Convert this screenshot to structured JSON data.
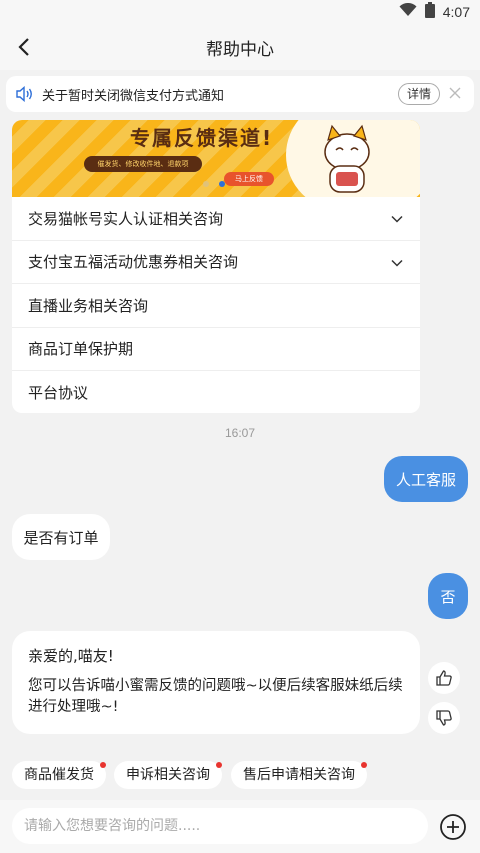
{
  "status_bar": {
    "time": "4:07"
  },
  "header": {
    "title": "帮助中心"
  },
  "notice": {
    "text": "关于暂时关闭微信支付方式通知",
    "detail_label": "详情"
  },
  "banner": {
    "headline": "专属反馈渠道!",
    "pill_text": "催发货、修改收件地、退款项",
    "button_text": "马上反馈"
  },
  "faq_items": [
    {
      "label": "交易猫帐号实人认证相关咨询",
      "expandable": true
    },
    {
      "label": "支付宝五福活动优惠券相关咨询",
      "expandable": true
    },
    {
      "label": "直播业务相关咨询",
      "expandable": false
    },
    {
      "label": "商品订单保护期",
      "expandable": false
    },
    {
      "label": "平台协议",
      "expandable": false
    }
  ],
  "chat": {
    "timestamp": "16:07",
    "messages": [
      {
        "from": "user",
        "text": "人工客服"
      },
      {
        "from": "bot",
        "text": "是否有订单"
      },
      {
        "from": "user",
        "text": "否"
      },
      {
        "from": "bot",
        "lines": [
          "亲爱的,喵友!",
          "您可以告诉喵小蜜需反馈的问题哦~以便后续客服妹纸后续进行处理哦~!"
        ]
      }
    ]
  },
  "quick_replies": [
    {
      "label": "商品催发货",
      "dot": true
    },
    {
      "label": "申诉相关咨询",
      "dot": true
    },
    {
      "label": "售后申请相关咨询",
      "dot": true
    }
  ],
  "input": {
    "placeholder": "请输入您想要咨询的问题....."
  },
  "colors": {
    "accent": "#4a90e2",
    "badge": "#e8342f",
    "background": "#f2f2f2"
  }
}
